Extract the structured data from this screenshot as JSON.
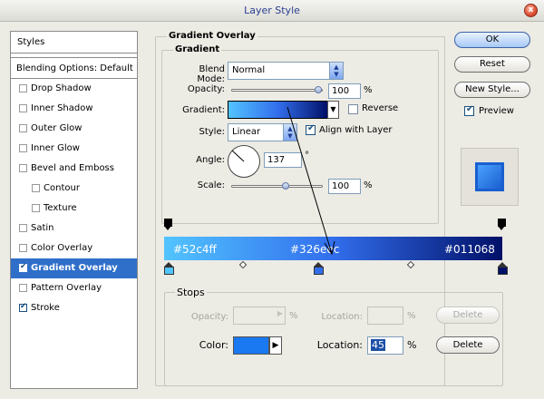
{
  "window": {
    "title": "Layer Style",
    "close_label": "x"
  },
  "styles_panel": {
    "header": "Styles",
    "blending": "Blending Options: Default",
    "items": [
      {
        "label": "Drop Shadow",
        "checked": false,
        "selected": false,
        "indent": false
      },
      {
        "label": "Inner Shadow",
        "checked": false,
        "selected": false,
        "indent": false
      },
      {
        "label": "Outer Glow",
        "checked": false,
        "selected": false,
        "indent": false
      },
      {
        "label": "Inner Glow",
        "checked": false,
        "selected": false,
        "indent": false
      },
      {
        "label": "Bevel and Emboss",
        "checked": false,
        "selected": false,
        "indent": false
      },
      {
        "label": "Contour",
        "checked": false,
        "selected": false,
        "indent": true
      },
      {
        "label": "Texture",
        "checked": false,
        "selected": false,
        "indent": true
      },
      {
        "label": "Satin",
        "checked": false,
        "selected": false,
        "indent": false
      },
      {
        "label": "Color Overlay",
        "checked": false,
        "selected": false,
        "indent": false
      },
      {
        "label": "Gradient Overlay",
        "checked": true,
        "selected": true,
        "indent": false
      },
      {
        "label": "Pattern Overlay",
        "checked": false,
        "selected": false,
        "indent": false
      },
      {
        "label": "Stroke",
        "checked": true,
        "selected": false,
        "indent": false
      }
    ]
  },
  "gradient_overlay": {
    "group_title": "Gradient Overlay",
    "sub_title": "Gradient",
    "blend_mode_label": "Blend Mode:",
    "blend_mode_value": "Normal",
    "opacity_label": "Opacity:",
    "opacity_value": "100",
    "opacity_unit": "%",
    "gradient_label": "Gradient:",
    "reverse_label": "Reverse",
    "style_label": "Style:",
    "style_value": "Linear",
    "align_label": "Align with Layer",
    "angle_label": "Angle:",
    "angle_value": "137",
    "angle_unit": "°",
    "scale_label": "Scale:",
    "scale_value": "100",
    "scale_unit": "%"
  },
  "gradient_editor": {
    "stop_left": "#52c4ff",
    "stop_mid": "#326eec",
    "stop_right": "#011068",
    "colors": {
      "left": "#52c4ff",
      "mid": "#326eec",
      "right": "#011068"
    }
  },
  "stops": {
    "title": "Stops",
    "opacity_label": "Opacity:",
    "opacity_unit": "%",
    "location_label": "Location:",
    "location_unit": "%",
    "delete_label": "Delete",
    "color_label": "Color:",
    "color_value": "#1a78f0",
    "color_location_label": "Location:",
    "color_location_value": "45",
    "color_location_unit": "%",
    "color_delete_label": "Delete"
  },
  "buttons": {
    "ok": "OK",
    "reset": "Reset",
    "new_style": "New Style...",
    "preview": "Preview"
  },
  "icons": {
    "dropdown": "chevron-down-icon",
    "spinner": "spinner-arrows-icon",
    "close": "close-icon"
  }
}
